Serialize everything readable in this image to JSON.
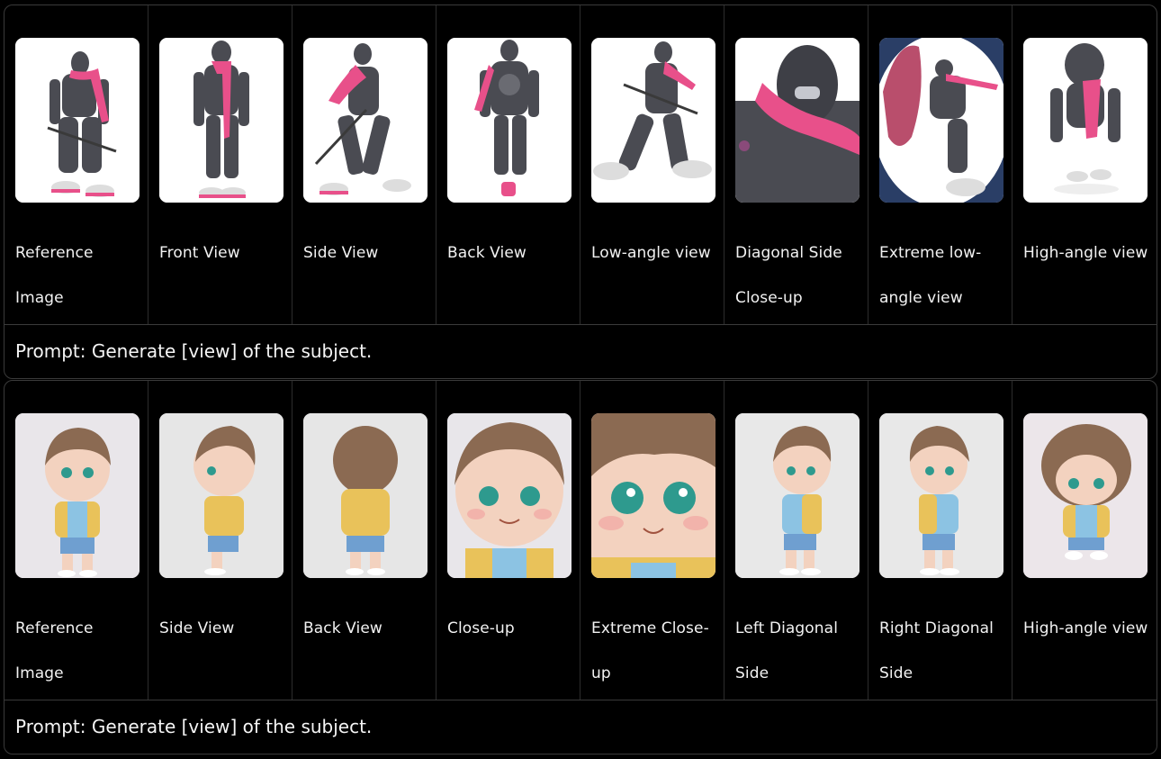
{
  "rows": [
    {
      "subject": "robot ninja with pink scarf",
      "views": [
        {
          "label": "Reference Image",
          "icon": "robot-figure-reference"
        },
        {
          "label": "Front View",
          "icon": "robot-figure-front"
        },
        {
          "label": "Side View",
          "icon": "robot-figure-side"
        },
        {
          "label": "Back View",
          "icon": "robot-figure-back"
        },
        {
          "label": "Low-angle view",
          "icon": "robot-figure-low-angle"
        },
        {
          "label": "Diagonal Side Close-up",
          "icon": "robot-figure-diagonal-closeup"
        },
        {
          "label": "Extreme low-angle view",
          "icon": "robot-figure-extreme-low-angle"
        },
        {
          "label": "High-angle view",
          "icon": "robot-figure-high-angle"
        }
      ],
      "prompt": "Prompt: Generate [view] of the subject."
    },
    {
      "subject": "chibi boy in yellow vest",
      "views": [
        {
          "label": "Reference Image",
          "icon": "chibi-boy-reference"
        },
        {
          "label": "Side View",
          "icon": "chibi-boy-side"
        },
        {
          "label": "Back View",
          "icon": "chibi-boy-back"
        },
        {
          "label": "Close-up",
          "icon": "chibi-boy-closeup"
        },
        {
          "label": "Extreme Close-up",
          "icon": "chibi-boy-extreme-closeup"
        },
        {
          "label": "Left Diagonal Side",
          "icon": "chibi-boy-left-diagonal"
        },
        {
          "label": "Right Diagonal Side",
          "icon": "chibi-boy-right-diagonal"
        },
        {
          "label": "High-angle view",
          "icon": "chibi-boy-high-angle"
        }
      ],
      "prompt": "Prompt: Generate [view] of the subject."
    }
  ],
  "colors": {
    "background": "#000000",
    "border": "#3a3a3a",
    "scarf_pink": "#e8508a",
    "robot_gray": "#4a4b52",
    "hair_brown": "#8b6a52",
    "vest_yellow": "#e9c25a",
    "shirt_blue": "#8cc3e3"
  }
}
